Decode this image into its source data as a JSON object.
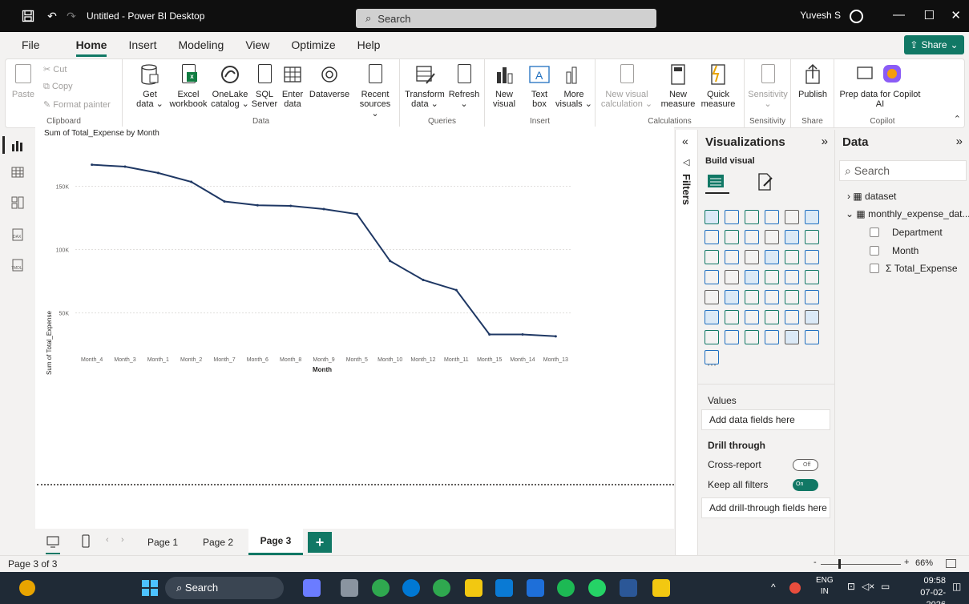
{
  "titlebar": {
    "app_title": "Untitled - Power BI Desktop",
    "search_placeholder": "Search",
    "user_name": "Yuvesh S"
  },
  "menu": {
    "items": [
      "File",
      "Home",
      "Insert",
      "Modeling",
      "View",
      "Optimize",
      "Help"
    ],
    "active": "Home",
    "share_label": "Share"
  },
  "ribbon": {
    "clipboard": {
      "paste": "Paste",
      "cut": "Cut",
      "copy": "Copy",
      "format_painter": "Format painter",
      "label": "Clipboard"
    },
    "data": {
      "get_data_1": "Get",
      "get_data_2": "data ⌄",
      "excel_1": "Excel",
      "excel_2": "workbook",
      "onelake_1": "OneLake",
      "onelake_2": "catalog ⌄",
      "sql_1": "SQL",
      "sql_2": "Server",
      "enter_1": "Enter",
      "enter_2": "data",
      "dataverse": "Dataverse",
      "recent_1": "Recent",
      "recent_2": "sources ⌄",
      "label": "Data"
    },
    "queries": {
      "transform_1": "Transform",
      "transform_2": "data ⌄",
      "refresh_1": "Refresh",
      "refresh_2": "⌄",
      "label": "Queries"
    },
    "insert": {
      "new_visual_1": "New",
      "new_visual_2": "visual",
      "text_box_1": "Text",
      "text_box_2": "box",
      "more_1": "More",
      "more_2": "visuals ⌄",
      "label": "Insert"
    },
    "calculations": {
      "new_visual_calc_1": "New visual",
      "new_visual_calc_2": "calculation ⌄",
      "new_measure_1": "New",
      "new_measure_2": "measure",
      "quick_measure_1": "Quick",
      "quick_measure_2": "measure",
      "label": "Calculations"
    },
    "sensitivity": {
      "btn": "Sensitivity",
      "btn2": "⌄",
      "label": "Sensitivity"
    },
    "share": {
      "publish": "Publish",
      "label": "Share"
    },
    "copilot": {
      "prep_1": "Prep data for Copilot",
      "prep_2": "AI",
      "label": "Copilot"
    }
  },
  "chart_data": {
    "type": "line",
    "title": "Sum of Total_Expense by Month",
    "xlabel": "Month",
    "ylabel": "Sum of Total_Expense",
    "categories": [
      "Month_4",
      "Month_3",
      "Month_1",
      "Month_2",
      "Month_7",
      "Month_6",
      "Month_8",
      "Month_9",
      "Month_5",
      "Month_10",
      "Month_12",
      "Month_11",
      "Month_15",
      "Month_14",
      "Month_13"
    ],
    "values": [
      167000,
      165500,
      160500,
      153500,
      138000,
      135000,
      134500,
      132000,
      128000,
      91000,
      76000,
      68000,
      33000,
      33000,
      31500
    ],
    "yticks": [
      50000,
      100000,
      150000
    ],
    "ytick_labels": [
      "50K",
      "100K",
      "150K"
    ],
    "ylim": [
      20000,
      175000
    ],
    "grid": true,
    "line_color": "#1f3864"
  },
  "pages": {
    "tabs": [
      "Page 1",
      "Page 2",
      "Page 3"
    ],
    "active": "Page 3",
    "add": "+"
  },
  "filters": {
    "label": "Filters"
  },
  "visualizations": {
    "title": "Visualizations",
    "build_visual": "Build visual",
    "values_label": "Values",
    "values_placeholder": "Add data fields here",
    "drill_through": "Drill through",
    "cross_report": "Cross-report",
    "cross_report_state": "Off",
    "keep_all_filters": "Keep all filters",
    "keep_all_filters_state": "On",
    "drill_placeholder": "Add drill-through fields here",
    "more": "···"
  },
  "data_pane": {
    "title": "Data",
    "search_placeholder": "Search",
    "tables": [
      {
        "name": "dataset",
        "expanded": false
      },
      {
        "name": "monthly_expense_dat...",
        "expanded": true,
        "fields": [
          "Department",
          "Month",
          "Total_Expense"
        ]
      }
    ],
    "sigma": "Σ"
  },
  "status": {
    "page_info": "Page 3 of 3",
    "zoom": "66%"
  },
  "taskbar": {
    "search": "Search",
    "lang_1": "ENG",
    "lang_2": "IN",
    "time": "09:58",
    "date": "07-02-2026"
  }
}
